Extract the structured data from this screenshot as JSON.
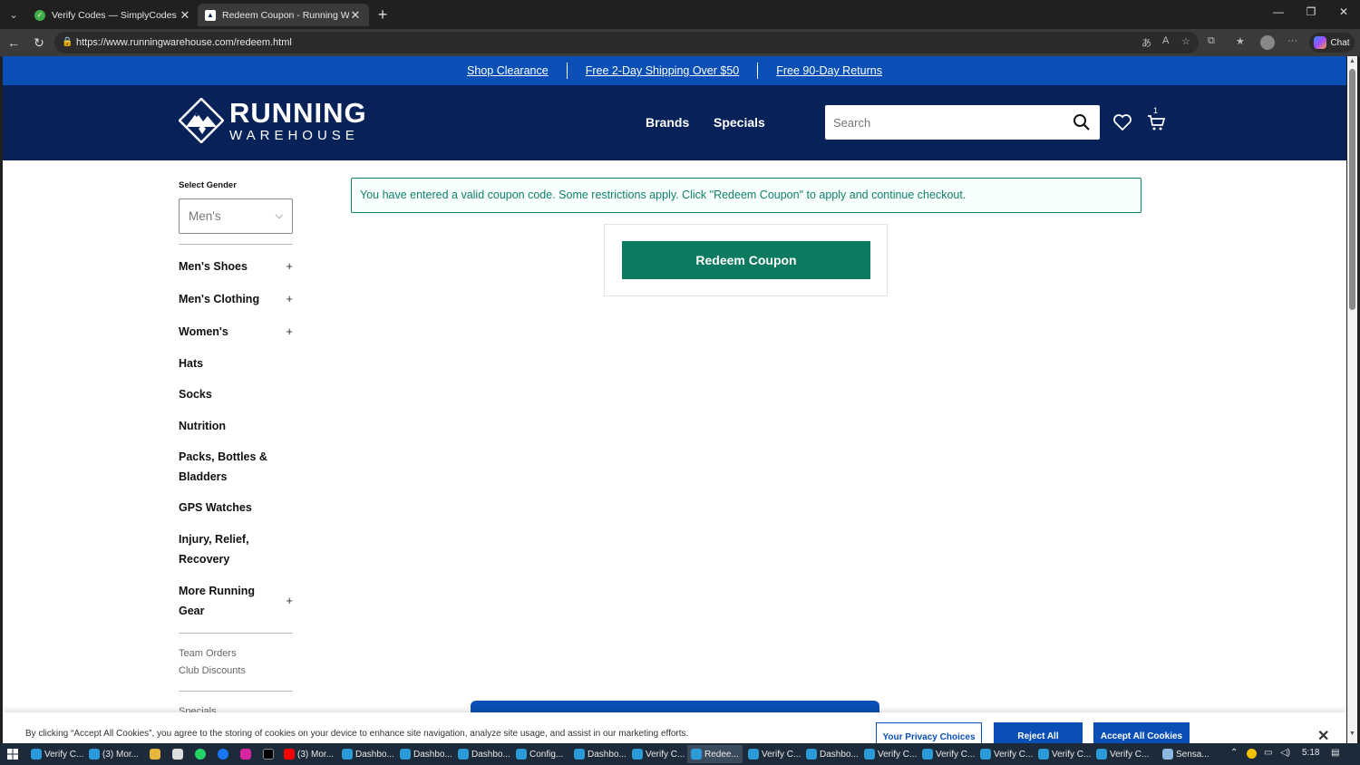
{
  "browser": {
    "tabs": [
      {
        "title": "Verify Codes — SimplyCodes",
        "close": "✕"
      },
      {
        "title": "Redeem Coupon - Running Wareh",
        "close": "✕"
      }
    ],
    "new_tab": "+",
    "url": "https://www.runningwarehouse.com/redeem.html",
    "chat_label": "Chat",
    "window": {
      "minimize": "—",
      "restore": "❐",
      "close": "✕"
    }
  },
  "promo": {
    "links": [
      "Shop Clearance",
      "Free 2-Day Shipping Over $50",
      "Free 90-Day Returns"
    ]
  },
  "header": {
    "logo_line1": "RUNNING",
    "logo_line2": "WAREHOUSE",
    "nav": [
      "Brands",
      "Specials"
    ],
    "search_placeholder": "Search",
    "cart_count": "1"
  },
  "sidebar": {
    "select_label": "Select Gender",
    "gender_value": "Men's",
    "items": [
      {
        "label": "Men's Shoes",
        "expand": "+"
      },
      {
        "label": "Men's Clothing",
        "expand": "+"
      },
      {
        "label": "Women's",
        "expand": "+"
      },
      {
        "label": "Hats"
      },
      {
        "label": "Socks"
      },
      {
        "label": "Nutrition"
      },
      {
        "label": "Packs, Bottles &",
        "label2": "Bladders"
      },
      {
        "label": "GPS Watches"
      },
      {
        "label": "Injury, Relief,",
        "label2": "Recovery"
      },
      {
        "label": "More Running",
        "label2": "Gear",
        "expand": "+"
      }
    ],
    "sub_links": [
      "Team Orders",
      "Club Discounts",
      "Specials"
    ]
  },
  "main": {
    "alert": "You have entered a valid coupon code. Some restrictions apply. Click \"Redeem Coupon\" to apply and continue checkout.",
    "redeem_button": "Redeem Coupon"
  },
  "cookie": {
    "text": "By clicking “Accept All Cookies”, you agree to the storing of cookies on your device to enhance site navigation, analyze site usage, and assist in our marketing efforts.",
    "privacy_button": "Your Privacy Choices",
    "reject_button": "Reject All",
    "accept_button": "Accept All Cookies",
    "close": "✕"
  },
  "taskbar": {
    "items": [
      "Verify C...",
      "(3) Mor...",
      "(3) Mor...",
      "Dashbo...",
      "Dashbo...",
      "Dashbo...",
      "Config...",
      "Dashbo...",
      "Verify C...",
      "Redee...",
      "Verify C...",
      "Dashbo...",
      "Verify C...",
      "Verify C...",
      "Verify C...",
      "Verify C...",
      "Verify C...",
      "Sensa..."
    ],
    "clock": "5:18"
  },
  "colors": {
    "promo_blue": "#0a4fb5",
    "header_navy": "#072259",
    "success_green": "#14806a",
    "button_green": "#0c7a61"
  }
}
